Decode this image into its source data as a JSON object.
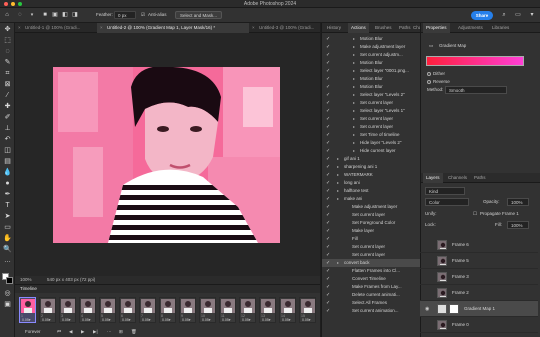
{
  "app": {
    "title": "Adobe Photoshop 2024"
  },
  "options_bar": {
    "feather_label": "Feather:",
    "feather_value": "0 px",
    "anti_alias_label": "Anti-alias",
    "select_mask_label": "Select and Mask...",
    "share_label": "Share"
  },
  "doc_tabs": [
    {
      "label": "Untitled-1 @ 100% (Gradi..."
    },
    {
      "label": "Untitled-2 @ 100% (Gradient Map 1, Layer Mask/16) *"
    },
    {
      "label": "Untitled-3 @ 100% (Gradi..."
    }
  ],
  "status": {
    "zoom": "100%",
    "doc_size": "540 px x 403 px (72 ppi)"
  },
  "timeline": {
    "title": "Timeline",
    "frames": [
      {
        "num": "1",
        "time": "0.05▾"
      },
      {
        "num": "2",
        "time": "0.05▾"
      },
      {
        "num": "3",
        "time": "0.05▾"
      },
      {
        "num": "4",
        "time": "0.05▾"
      },
      {
        "num": "5",
        "time": "0.05▾"
      },
      {
        "num": "6",
        "time": "0.05▾"
      },
      {
        "num": "7",
        "time": "0.05▾"
      },
      {
        "num": "8",
        "time": "0.05▾"
      },
      {
        "num": "9",
        "time": "0.05▾"
      },
      {
        "num": "10",
        "time": "0.05▾"
      },
      {
        "num": "11",
        "time": "0.05▾"
      },
      {
        "num": "12",
        "time": "0.05▾"
      },
      {
        "num": "13",
        "time": "0.05▾"
      },
      {
        "num": "14",
        "time": "0.05▾"
      },
      {
        "num": "15",
        "time": "0.05▾"
      }
    ],
    "loop_label": "Forever"
  },
  "history_panel": {
    "tabs": [
      "History",
      "Actions",
      "Brushes",
      "Paths",
      "Channels"
    ],
    "actions": [
      {
        "label": "Motion Blur",
        "level": 2
      },
      {
        "label": "Make adjustment layer",
        "level": 2
      },
      {
        "label": "Set current adjustm...",
        "level": 2
      },
      {
        "label": "Motion Blur",
        "level": 2
      },
      {
        "label": "Select layer \"0001.png...",
        "level": 2
      },
      {
        "label": "Motion Blur",
        "level": 2
      },
      {
        "label": "Motion Blur",
        "level": 2
      },
      {
        "label": "Select layer \"Levels 2\"",
        "level": 2
      },
      {
        "label": "Set current layer",
        "level": 2
      },
      {
        "label": "Select layer \"Levels 1\"",
        "level": 2
      },
      {
        "label": "Set current layer",
        "level": 2
      },
      {
        "label": "Set current layer",
        "level": 2
      },
      {
        "label": "Set Time of timeline",
        "level": 2
      },
      {
        "label": "Hide layer \"Levels 2\"",
        "level": 2
      },
      {
        "label": "Hide current layer",
        "level": 2
      },
      {
        "label": "gif ani 1",
        "level": 0
      },
      {
        "label": "sharpening ani 1",
        "level": 0
      },
      {
        "label": "WATERMARK",
        "level": 0
      },
      {
        "label": "long ani",
        "level": 0
      },
      {
        "label": "halftone test",
        "level": 0
      },
      {
        "label": "make ani",
        "level": 0
      },
      {
        "label": "Make adjustment layer",
        "level": 1
      },
      {
        "label": "Set current layer",
        "level": 1
      },
      {
        "label": "Set Foreground Color",
        "level": 1
      },
      {
        "label": "Make layer",
        "level": 1
      },
      {
        "label": "Fill",
        "level": 1
      },
      {
        "label": "Set current layer",
        "level": 1
      },
      {
        "label": "Set current layer",
        "level": 1
      },
      {
        "label": "convert back",
        "level": 0
      },
      {
        "label": "Flatten Frames into Cl...",
        "level": 1
      },
      {
        "label": "Convert Timeline",
        "level": 1
      },
      {
        "label": "Make Frames from Lay...",
        "level": 1
      },
      {
        "label": "Delete current animati...",
        "level": 1
      },
      {
        "label": "Select All Frames",
        "level": 1
      },
      {
        "label": "Set current animation...",
        "level": 1
      }
    ]
  },
  "properties_panel": {
    "tabs": [
      "Properties",
      "Adjustments",
      "Libraries"
    ],
    "title": "Gradient Map",
    "dither_label": "Dither",
    "reverse_label": "Reverse",
    "method_label": "Method:",
    "method_value": "Smooth"
  },
  "layers_panel": {
    "tabs": [
      "Layers",
      "Channels",
      "Paths"
    ],
    "kind_label": "Kind",
    "blend_mode": "Color",
    "opacity_label": "Opacity:",
    "opacity_value": "100%",
    "unify_label": "Unify:",
    "propagate_label": "Propagate Frame 1",
    "lock_label": "Lock:",
    "fill_label": "Fill:",
    "fill_value": "100%",
    "layers": [
      {
        "name": "Frame 6",
        "type": "photo"
      },
      {
        "name": "Frame 5",
        "type": "photo"
      },
      {
        "name": "Frame 3",
        "type": "photo"
      },
      {
        "name": "Frame 2",
        "type": "photo"
      },
      {
        "name": "Gradient Map 1",
        "type": "adjustment"
      },
      {
        "name": "Frame 0",
        "type": "photo"
      }
    ]
  },
  "colors": {
    "accent": "#2680eb",
    "photo_pink": "#ff4f8b",
    "gradient_start": "#ff1f3d",
    "gradient_end": "#ff3fd6"
  }
}
